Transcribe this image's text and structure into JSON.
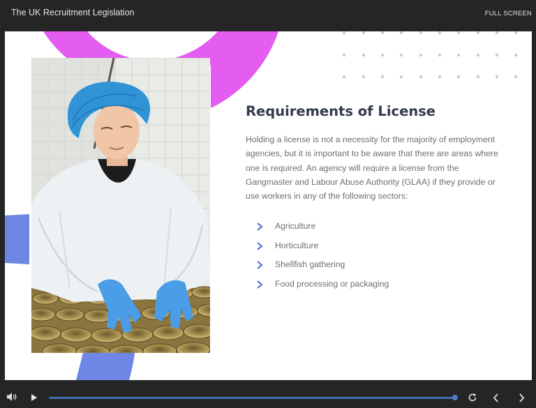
{
  "header": {
    "course_title": "The UK Recruitment Legislation",
    "fullscreen_label": "FULL SCREEN"
  },
  "slide": {
    "heading": "Requirements of License",
    "paragraph": "Holding a license is not a necessity for the majority of employment agencies, but it is important to be aware that there are areas where one is required. An agency will require a license from the Gangmaster and Labour Abuse Authority (GLAA) if they provide or use workers in any of the following sectors:",
    "sectors": [
      "Agriculture",
      "Horticulture",
      "Shellfish gathering",
      "Food processing or packaging"
    ],
    "photo_subject": "worker-in-food-processing-plant"
  },
  "player": {
    "progress": 0.99,
    "icons": [
      "volume-icon",
      "play-icon",
      "replay-icon",
      "previous-icon",
      "next-icon"
    ]
  },
  "colors": {
    "accent_pink": "#e25cf2",
    "accent_blue": "#6b86e3",
    "chevron_blue": "#5b78d6",
    "heading": "#333a4b",
    "bar_bg": "#252525"
  }
}
